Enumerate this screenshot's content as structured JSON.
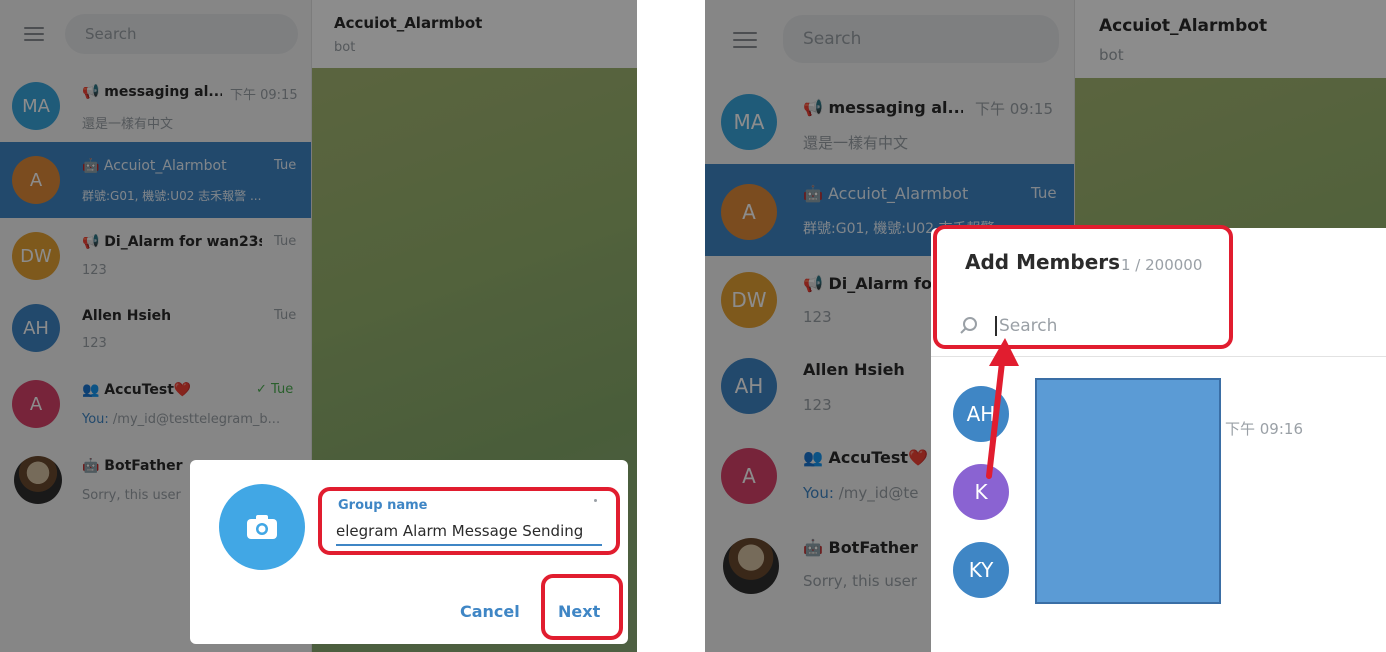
{
  "colors": {
    "accent": "#3f86c5",
    "highlight_box": "#e11d2f",
    "avatar_ma": "#3aa6dc",
    "avatar_a_orange": "#e08a3a",
    "avatar_dw": "#e6a233",
    "avatar_ah": "#3f86c5",
    "avatar_a_pink": "#d9436a",
    "avatar_k": "#8a63d2",
    "avatar_ky": "#3f86c5",
    "redacted": "#5b9bd5"
  },
  "left": {
    "search_placeholder": "Search",
    "header": {
      "title": "Accuiot_Alarmbot",
      "subtitle": "bot"
    },
    "chats": [
      {
        "initials": "MA",
        "name": "📢 messaging al...",
        "time": "下午 09:15",
        "preview": "還是一樣有中文"
      },
      {
        "initials": "A",
        "name": "🤖 Accuiot_Alarmbot",
        "time": "Tue",
        "preview": "群號:G01, 機號:U02 志禾報警 ..."
      },
      {
        "initials": "DW",
        "name": "📢 Di_Alarm for wan23s",
        "time": "Tue",
        "preview": "123"
      },
      {
        "initials": "AH",
        "name": "Allen Hsieh",
        "time": "Tue",
        "preview": "123"
      },
      {
        "initials": "A",
        "name": "👥 AccuTest❤️",
        "time": "✓ Tue",
        "preview_prefix": "You:",
        "preview": " /my_id@testtelegram_b..."
      },
      {
        "initials": "",
        "name": "🤖 BotFather",
        "time": "",
        "preview": "Sorry, this user"
      }
    ],
    "dialog": {
      "field_label": "Group name",
      "field_value": "elegram Alarm Message Sending",
      "cancel_label": "Cancel",
      "next_label": "Next",
      "camera_icon": "camera-icon"
    }
  },
  "right": {
    "search_placeholder": "Search",
    "header": {
      "title": "Accuiot_Alarmbot",
      "subtitle": "bot"
    },
    "chats": [
      {
        "initials": "MA",
        "name": "📢 messaging al...",
        "time": "下午 09:15",
        "preview": "還是一樣有中文"
      },
      {
        "initials": "A",
        "name": "🤖 Accuiot_Alarmbot",
        "time": "Tue",
        "preview": "群號:G01, 機號:U02 志禾報警"
      },
      {
        "initials": "DW",
        "name": "📢 Di_Alarm fo",
        "time": "",
        "preview": "123"
      },
      {
        "initials": "AH",
        "name": "Allen Hsieh",
        "time": "",
        "preview": "123"
      },
      {
        "initials": "A",
        "name": "👥 AccuTest❤️",
        "time": "",
        "preview_prefix": "You:",
        "preview": " /my_id@te"
      },
      {
        "initials": "",
        "name": "🤖 BotFather",
        "time": "",
        "preview": "Sorry, this user"
      }
    ],
    "dialog": {
      "title": "Add Members",
      "count": "1 / 200000",
      "search_placeholder": "Search",
      "members": [
        {
          "initials": "AH"
        },
        {
          "initials": "K"
        },
        {
          "initials": "KY"
        }
      ],
      "time": "下午 09:16"
    }
  }
}
